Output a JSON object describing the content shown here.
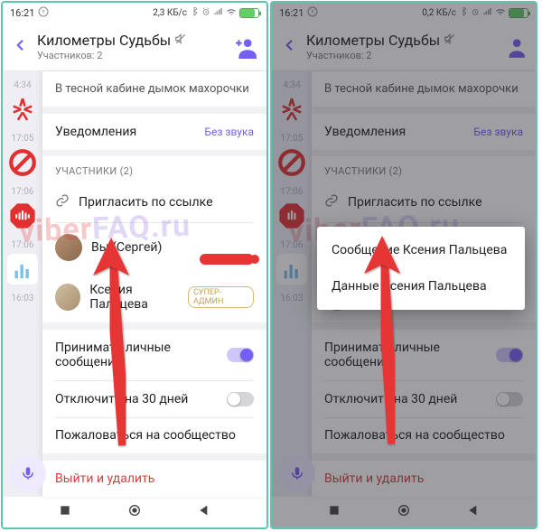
{
  "statusbar": {
    "time": "16:21",
    "net_left": "2,3 КБ/с",
    "net_right": "0,2 КБ/с"
  },
  "header": {
    "title": "Километры Судьбы",
    "subtitle": "Участников: 2"
  },
  "panel": {
    "description": "В тесной кабине дымок махорочки",
    "notifications_label": "Уведомления",
    "mute_label": "Без звука",
    "participants_header": "УЧАСТНИКИ (2)",
    "invite_label": "Пригласить по ссылке",
    "you_label": "Вы (Сергей)",
    "member_label": "Ксения Пальцева",
    "member_badge": "СУПЕР-АДМИН",
    "accept_pm_label": "Принимать личные сообщения",
    "disable_30_label": "Отключить на 30 дней",
    "report_label": "Пожаловаться на сообщество",
    "leave_label": "Выйти и удалить"
  },
  "context_menu": {
    "item1": "Сообщение Ксения Пальцева",
    "item2": "Данные Ксения Пальцева"
  },
  "peek": {
    "t1": "4:34",
    "t2": "17:05",
    "t3": "17:06",
    "t4": "17:06",
    "t5": "16:03"
  },
  "watermark": {
    "a": "viber",
    "b": "FAQ.ru"
  }
}
